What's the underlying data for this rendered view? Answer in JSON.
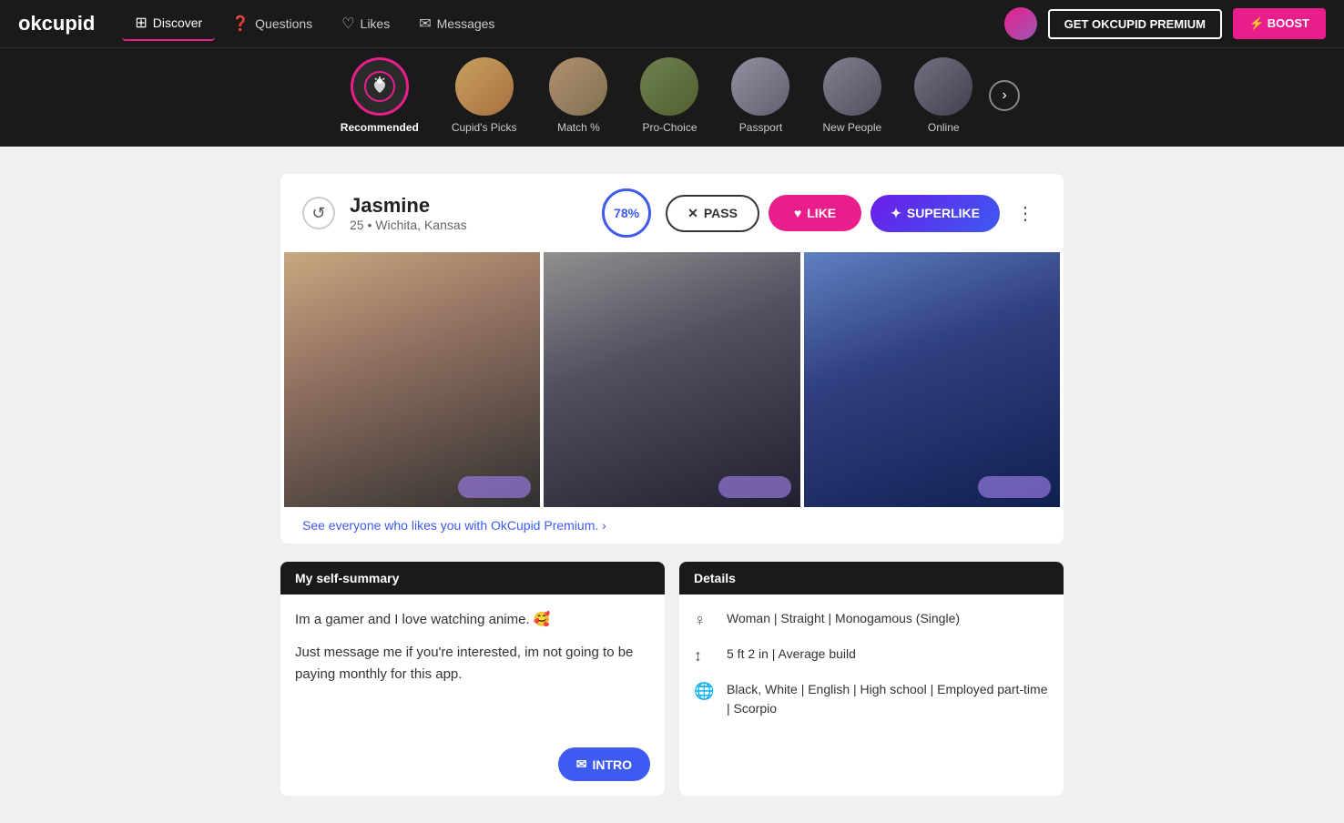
{
  "app": {
    "logo": "okcupid",
    "premium_btn": "GET OKCUPID PREMIUM",
    "boost_btn": "⚡ BOOST"
  },
  "nav": {
    "items": [
      {
        "label": "Discover",
        "icon": "⊞",
        "active": true
      },
      {
        "label": "Questions",
        "icon": "❓",
        "active": false
      },
      {
        "label": "Likes",
        "icon": "♡",
        "active": false
      },
      {
        "label": "Messages",
        "icon": "✉",
        "active": false
      }
    ]
  },
  "categories": [
    {
      "label": "Recommended",
      "active": true
    },
    {
      "label": "Cupid's Picks",
      "active": false
    },
    {
      "label": "Match %",
      "active": false
    },
    {
      "label": "Pro-Choice",
      "active": false
    },
    {
      "label": "Passport",
      "active": false
    },
    {
      "label": "New People",
      "active": false
    },
    {
      "label": "Online",
      "active": false
    }
  ],
  "profile": {
    "name": "Jasmine",
    "age": "25",
    "location": "Wichita, Kansas",
    "match_pct": "78%",
    "pass_label": "PASS",
    "like_label": "LIKE",
    "superlike_label": "SUPERLIKE",
    "premium_link": "See everyone who likes you with OkCupid Premium. ›",
    "self_summary_header": "My self-summary",
    "self_summary_p1": "Im a gamer and I love watching anime. 🥰",
    "self_summary_p2": "Just message me if you're interested, im not going to be paying monthly for this app.",
    "intro_label": "INTRO",
    "details_header": "Details",
    "details": [
      {
        "icon": "♀",
        "text": "Woman | Straight | Monogamous (Single)"
      },
      {
        "icon": "↕",
        "text": "5 ft 2 in | Average build"
      },
      {
        "icon": "🌐",
        "text": "Black, White | English | High school | Employed part-time | Scorpio"
      }
    ]
  }
}
